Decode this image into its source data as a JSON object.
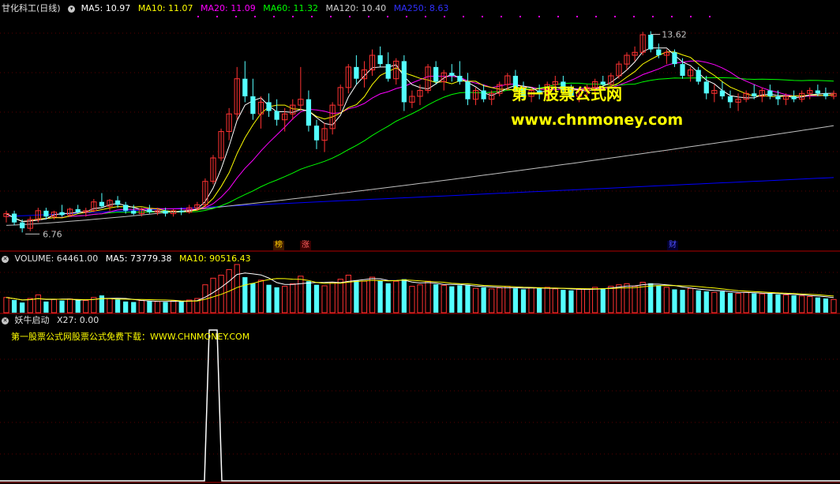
{
  "main_header": {
    "title": "甘化科工(日线)",
    "ma5": "MA5: 10.97",
    "ma10": "MA10: 11.07",
    "ma20": "MA20: 11.09",
    "ma60": "MA60: 11.32",
    "ma120": "MA120: 10.40",
    "ma250": "MA250: 8.63"
  },
  "volume_header": {
    "title": "VOLUME: 64461.00",
    "ma5": "MA5: 73779.38",
    "ma10": "MA10: 90516.43"
  },
  "indicator_header": {
    "title": "妖牛启动",
    "value": "X27: 0.00"
  },
  "labels": {
    "high": "13.62",
    "low": "6.76",
    "tag_bang": "榜",
    "tag_zhang": "涨",
    "tag_cai": "财"
  },
  "watermark": {
    "line1": "第一股票公式网",
    "line2": "www.chnmoney.com",
    "promo": "第一股票公式网股票公式免费下载：WWW.CHNMONEY.COM"
  },
  "colors": {
    "up": "#ff3232",
    "down": "#54ffff",
    "ma5": "#ffffff",
    "ma10": "#ffff00",
    "ma20": "#ff00ff",
    "ma60": "#00ff00",
    "ma120": "#c0c0c0",
    "ma250": "#0000ff",
    "divider": "#b00000"
  },
  "chart_data": [
    {
      "type": "candlestick",
      "title": "甘化科工(日线)",
      "ohlc": [
        [
          7.3,
          7.5,
          7.1,
          7.4
        ],
        [
          7.4,
          7.5,
          7.0,
          7.1
        ],
        [
          7.1,
          7.2,
          6.76,
          6.9
        ],
        [
          6.9,
          7.3,
          6.8,
          7.2
        ],
        [
          7.2,
          7.6,
          7.1,
          7.5
        ],
        [
          7.5,
          7.6,
          7.2,
          7.3
        ],
        [
          7.3,
          7.5,
          7.2,
          7.45
        ],
        [
          7.45,
          7.7,
          7.3,
          7.35
        ],
        [
          7.35,
          7.6,
          7.3,
          7.55
        ],
        [
          7.55,
          7.7,
          7.4,
          7.45
        ],
        [
          7.45,
          7.6,
          7.3,
          7.5
        ],
        [
          7.5,
          7.9,
          7.45,
          7.8
        ],
        [
          7.8,
          8.1,
          7.6,
          7.65
        ],
        [
          7.65,
          7.9,
          7.5,
          7.85
        ],
        [
          7.85,
          8.0,
          7.6,
          7.7
        ],
        [
          7.7,
          7.8,
          7.4,
          7.5
        ],
        [
          7.5,
          7.7,
          7.35,
          7.4
        ],
        [
          7.4,
          7.6,
          7.3,
          7.55
        ],
        [
          7.55,
          7.7,
          7.4,
          7.45
        ],
        [
          7.45,
          7.6,
          7.35,
          7.5
        ],
        [
          7.5,
          7.6,
          7.3,
          7.4
        ],
        [
          7.4,
          7.55,
          7.3,
          7.5
        ],
        [
          7.5,
          7.6,
          7.35,
          7.45
        ],
        [
          7.45,
          7.7,
          7.4,
          7.6
        ],
        [
          7.6,
          7.8,
          7.5,
          7.7
        ],
        [
          7.7,
          8.6,
          7.6,
          8.5
        ],
        [
          8.5,
          9.4,
          8.4,
          9.3
        ],
        [
          9.3,
          10.3,
          9.2,
          10.2
        ],
        [
          10.2,
          11.0,
          9.9,
          10.8
        ],
        [
          10.8,
          12.4,
          10.6,
          12.0
        ],
        [
          12.0,
          12.6,
          11.2,
          11.4
        ],
        [
          11.4,
          12.0,
          10.6,
          10.8
        ],
        [
          10.8,
          11.4,
          10.3,
          11.2
        ],
        [
          11.2,
          11.5,
          10.7,
          10.9
        ],
        [
          10.9,
          11.3,
          10.4,
          10.6
        ],
        [
          10.6,
          11.0,
          10.2,
          10.8
        ],
        [
          10.8,
          11.3,
          10.6,
          11.1
        ],
        [
          11.1,
          12.4,
          10.9,
          11.3
        ],
        [
          11.3,
          11.6,
          10.2,
          10.4
        ],
        [
          10.4,
          10.6,
          9.6,
          9.9
        ],
        [
          9.9,
          10.5,
          9.5,
          10.3
        ],
        [
          10.3,
          11.2,
          10.1,
          11.1
        ],
        [
          11.1,
          11.8,
          10.9,
          11.7
        ],
        [
          11.7,
          12.5,
          11.5,
          12.4
        ],
        [
          12.4,
          12.8,
          11.8,
          12.0
        ],
        [
          12.0,
          12.6,
          11.7,
          12.3
        ],
        [
          12.3,
          13.0,
          12.1,
          12.8
        ],
        [
          12.8,
          13.1,
          12.4,
          12.5
        ],
        [
          12.5,
          12.9,
          11.9,
          12.0
        ],
        [
          12.0,
          12.7,
          11.8,
          12.6
        ],
        [
          12.6,
          12.8,
          10.9,
          11.2
        ],
        [
          11.2,
          11.6,
          11.0,
          11.4
        ],
        [
          11.4,
          11.8,
          11.1,
          11.6
        ],
        [
          11.6,
          12.5,
          11.5,
          12.4
        ],
        [
          12.4,
          12.6,
          11.8,
          11.9
        ],
        [
          11.9,
          12.3,
          11.6,
          12.2
        ],
        [
          12.2,
          12.5,
          11.9,
          12.1
        ],
        [
          12.1,
          12.6,
          11.8,
          11.9
        ],
        [
          11.9,
          12.2,
          11.1,
          11.3
        ],
        [
          11.3,
          11.7,
          11.1,
          11.6
        ],
        [
          11.6,
          11.8,
          11.2,
          11.3
        ],
        [
          11.3,
          11.6,
          11.1,
          11.5
        ],
        [
          11.5,
          11.9,
          11.4,
          11.8
        ],
        [
          11.8,
          12.2,
          11.6,
          12.1
        ],
        [
          12.1,
          12.3,
          11.6,
          11.7
        ],
        [
          11.7,
          11.9,
          11.3,
          11.4
        ],
        [
          11.4,
          11.7,
          11.2,
          11.6
        ],
        [
          11.6,
          11.8,
          11.3,
          11.5
        ],
        [
          11.5,
          11.9,
          11.3,
          11.8
        ],
        [
          11.8,
          12.1,
          11.6,
          11.9
        ],
        [
          11.9,
          12.1,
          11.5,
          11.6
        ],
        [
          11.6,
          11.8,
          11.3,
          11.4
        ],
        [
          11.4,
          11.7,
          11.2,
          11.6
        ],
        [
          11.6,
          11.8,
          11.4,
          11.7
        ],
        [
          11.7,
          12.0,
          11.5,
          11.9
        ],
        [
          11.9,
          12.1,
          11.7,
          11.8
        ],
        [
          11.8,
          12.2,
          11.7,
          12.1
        ],
        [
          12.1,
          12.6,
          12.0,
          12.5
        ],
        [
          12.5,
          12.9,
          12.3,
          12.8
        ],
        [
          12.8,
          13.1,
          12.6,
          12.9
        ],
        [
          12.9,
          13.6,
          12.8,
          13.5
        ],
        [
          13.5,
          13.62,
          12.9,
          13.0
        ],
        [
          13.0,
          13.2,
          12.7,
          12.8
        ],
        [
          12.8,
          13.0,
          12.5,
          12.9
        ],
        [
          12.9,
          13.0,
          12.4,
          12.5
        ],
        [
          12.5,
          12.7,
          12.0,
          12.1
        ],
        [
          12.1,
          12.4,
          11.9,
          12.3
        ],
        [
          12.3,
          12.4,
          11.8,
          11.9
        ],
        [
          11.9,
          12.1,
          11.3,
          11.5
        ],
        [
          11.5,
          11.8,
          11.2,
          11.6
        ],
        [
          11.6,
          11.9,
          11.3,
          11.4
        ],
        [
          11.4,
          11.6,
          11.0,
          11.2
        ],
        [
          11.2,
          11.5,
          10.9,
          11.3
        ],
        [
          11.3,
          11.6,
          11.2,
          11.5
        ],
        [
          11.5,
          11.8,
          11.3,
          11.4
        ],
        [
          11.4,
          11.7,
          11.2,
          11.6
        ],
        [
          11.6,
          11.8,
          11.3,
          11.4
        ],
        [
          11.4,
          11.6,
          11.1,
          11.3
        ],
        [
          11.3,
          11.5,
          11.1,
          11.4
        ],
        [
          11.4,
          11.6,
          11.2,
          11.3
        ],
        [
          11.3,
          11.6,
          11.2,
          11.5
        ],
        [
          11.5,
          11.7,
          11.3,
          11.6
        ],
        [
          11.6,
          11.8,
          11.4,
          11.5
        ],
        [
          11.5,
          11.7,
          11.3,
          11.4
        ],
        [
          11.4,
          11.6,
          11.3,
          11.5
        ]
      ],
      "ylim": [
        6.5,
        14.2
      ],
      "high_label": 13.62,
      "low_label": 6.76,
      "ma_final": {
        "MA5": 10.97,
        "MA10": 11.07,
        "MA20": 11.09,
        "MA60": 11.32,
        "MA120": 10.4,
        "MA250": 8.63
      }
    },
    {
      "type": "bar",
      "title": "VOLUME",
      "values": [
        30,
        25,
        20,
        28,
        35,
        22,
        26,
        24,
        27,
        25,
        24,
        30,
        34,
        28,
        26,
        22,
        21,
        24,
        23,
        22,
        21,
        23,
        22,
        25,
        28,
        55,
        68,
        74,
        85,
        95,
        70,
        58,
        64,
        55,
        50,
        52,
        57,
        72,
        62,
        55,
        53,
        60,
        66,
        74,
        64,
        62,
        70,
        64,
        58,
        62,
        66,
        52,
        55,
        62,
        56,
        54,
        52,
        54,
        55,
        48,
        50,
        47,
        49,
        52,
        48,
        46,
        49,
        48,
        50,
        47,
        45,
        44,
        46,
        47,
        50,
        48,
        52,
        55,
        57,
        52,
        60,
        58,
        54,
        50,
        46,
        45,
        48,
        44,
        42,
        40,
        42,
        39,
        38,
        40,
        38,
        37,
        38,
        36,
        35,
        34,
        33,
        32,
        30,
        28,
        26
      ],
      "final": 64461.0,
      "ma5": 73779.38,
      "ma10": 90516.43
    },
    {
      "type": "line",
      "title": "妖牛启动",
      "values_nonzero_at_index": 26,
      "value_final": 0.0
    }
  ]
}
